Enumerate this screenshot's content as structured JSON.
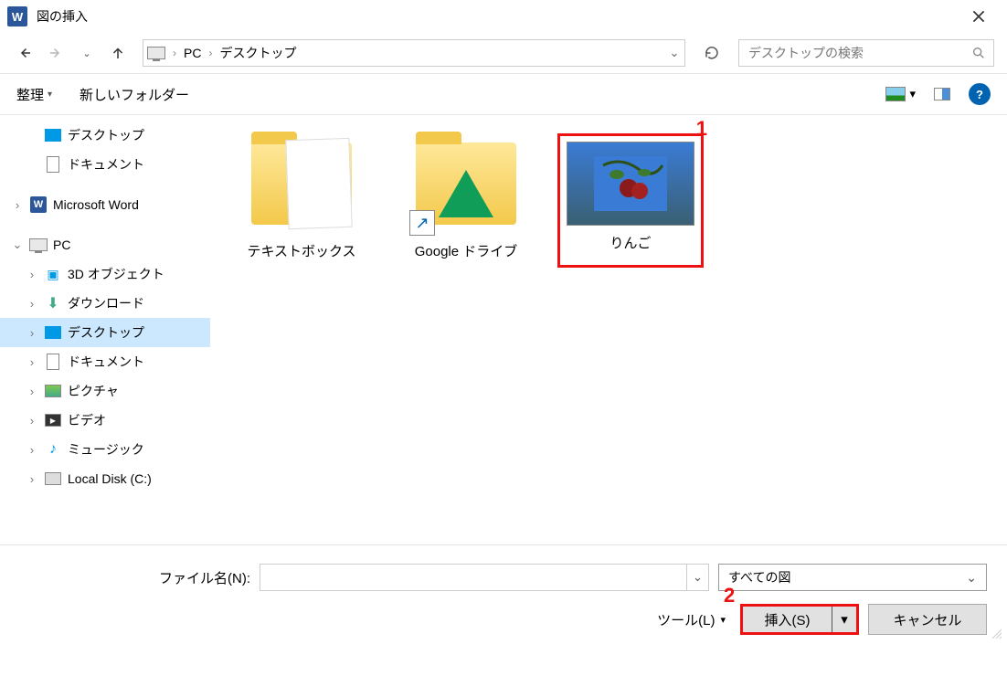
{
  "window": {
    "title": "図の挿入"
  },
  "nav": {
    "path_root": "PC",
    "path_current": "デスクトップ",
    "search_placeholder": "デスクトップの検索"
  },
  "toolbar": {
    "organize": "整理",
    "new_folder": "新しいフォルダー"
  },
  "sidebar": {
    "quick": [
      {
        "label": "デスクトップ",
        "icon": "desktop"
      },
      {
        "label": "ドキュメント",
        "icon": "document"
      }
    ],
    "word": "Microsoft Word",
    "pc": "PC",
    "pc_children": [
      {
        "label": "3D オブジェクト",
        "icon": "obj3d"
      },
      {
        "label": "ダウンロード",
        "icon": "download"
      },
      {
        "label": "デスクトップ",
        "icon": "desktop",
        "selected": true
      },
      {
        "label": "ドキュメント",
        "icon": "document"
      },
      {
        "label": "ピクチャ",
        "icon": "picture"
      },
      {
        "label": "ビデオ",
        "icon": "video"
      },
      {
        "label": "ミュージック",
        "icon": "music"
      },
      {
        "label": "Local Disk (C:)",
        "icon": "disk"
      }
    ]
  },
  "items": [
    {
      "label": "テキストボックス",
      "type": "folder-doc"
    },
    {
      "label": "Google ドライブ",
      "type": "folder-gdrive"
    },
    {
      "label": "りんご",
      "type": "image-apple",
      "selected": true
    }
  ],
  "callouts": {
    "one": "1",
    "two": "2"
  },
  "footer": {
    "filename_label": "ファイル名(N):",
    "filename_value": "",
    "filter": "すべての図",
    "tools": "ツール(L)",
    "insert": "挿入(S)",
    "cancel": "キャンセル"
  }
}
